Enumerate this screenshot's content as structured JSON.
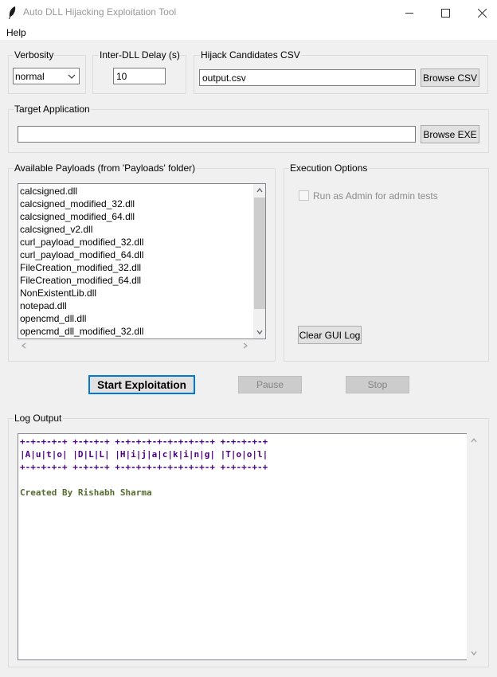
{
  "window": {
    "title": "Auto DLL Hijacking Exploitation Tool",
    "menu": [
      "Help"
    ]
  },
  "verbosity": {
    "label": "Verbosity",
    "value": "normal"
  },
  "delay": {
    "label": "Inter-DLL Delay (s)",
    "value": "10"
  },
  "csv": {
    "label": "Hijack Candidates CSV",
    "value": "output.csv",
    "browse_label": "Browse CSV"
  },
  "target": {
    "label": "Target Application",
    "value": "",
    "browse_label": "Browse EXE"
  },
  "payloads": {
    "label": "Available Payloads (from 'Payloads' folder)",
    "items": [
      "calcsigned.dll",
      "calcsigned_modified_32.dll",
      "calcsigned_modified_64.dll",
      "calcsigned_v2.dll",
      "curl_payload_modified_32.dll",
      "curl_payload_modified_64.dll",
      "FileCreation_modified_32.dll",
      "FileCreation_modified_64.dll",
      "NonExistentLib.dll",
      "notepad.dll",
      "opencmd_dll.dll",
      "opencmd_dll_modified_32.dll"
    ]
  },
  "execution": {
    "label": "Execution Options",
    "run_as_admin_label": "Run as Admin for admin tests",
    "run_as_admin_checked": false,
    "clear_log_label": "Clear GUI Log"
  },
  "actions": {
    "start": "Start Exploitation",
    "pause": "Pause",
    "stop": "Stop"
  },
  "log": {
    "label": "Log Output",
    "banner": [
      "+-+-+-+-+ +-+-+-+ +-+-+-+-+-+-+-+-+-+ +-+-+-+-+",
      "|A|u|t|o| |D|L|L| |H|i|j|a|c|k|i|n|g| |T|o|o|l|",
      "+-+-+-+-+ +-+-+-+ +-+-+-+-+-+-+-+-+-+ +-+-+-+-+"
    ],
    "credit": "Created By Rishabh Sharma"
  },
  "colors": {
    "banner": "#4b0082",
    "credit": "#556b2f",
    "primary_border": "#0078d7"
  }
}
